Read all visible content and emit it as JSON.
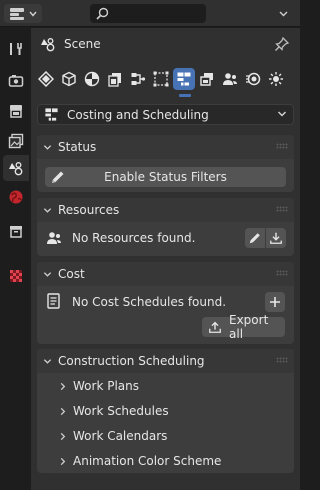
{
  "topbar": {
    "editor_icon": "properties-editor-icon",
    "search_placeholder": ""
  },
  "sidebar": {
    "tabs": [
      {
        "icon": "tool-icon",
        "active": false
      },
      {
        "icon": "render-icon",
        "active": false
      },
      {
        "icon": "output-icon",
        "active": false
      },
      {
        "icon": "view-layer-icon",
        "active": false
      },
      {
        "icon": "scene-icon",
        "active": true
      },
      {
        "icon": "world-icon",
        "active": false
      },
      {
        "icon": "collection-icon",
        "active": false
      },
      {
        "icon": "texture-icon",
        "active": false
      }
    ]
  },
  "scene": {
    "title": "Scene",
    "pin_icon": "pin-icon"
  },
  "context_tabs": {
    "icons": [
      "project-icon",
      "geometry-icon",
      "material-icon",
      "drawing-icon",
      "services-icon",
      "structural-icon",
      "scheduling-icon",
      "cost-icon",
      "group-icon",
      "quality-icon",
      "sun-icon"
    ],
    "active_index": 6
  },
  "dropdown": {
    "label": "Costing and Scheduling"
  },
  "panels": {
    "status": {
      "title": "Status",
      "button_label": "Enable Status Filters"
    },
    "resources": {
      "title": "Resources",
      "empty_text": "No Resources found."
    },
    "cost": {
      "title": "Cost",
      "empty_text": "No Cost Schedules found.",
      "export_label": "Export all"
    },
    "construction": {
      "title": "Construction Scheduling",
      "items": [
        "Work Plans",
        "Work Schedules",
        "Work Calendars",
        "Animation Color Scheme"
      ]
    }
  },
  "colors": {
    "accent": "#4772b3",
    "panel_bg": "#3d3d3d",
    "button_bg": "#545454",
    "editor_bg": "#303030"
  }
}
